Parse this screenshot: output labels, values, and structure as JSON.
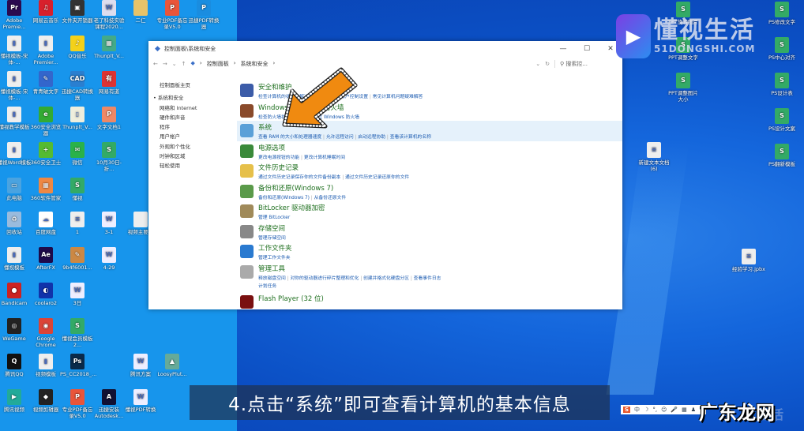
{
  "desktop": {
    "left_icons": [
      {
        "label": "Adobe Premie...",
        "c": "#2a0a4f",
        "g": "Pr"
      },
      {
        "label": "网易云音乐",
        "c": "#d8202c",
        "g": "♫"
      },
      {
        "label": "文件夹开锁器",
        "c": "#333",
        "g": "▣"
      },
      {
        "label": "老了科技实验课程2020...",
        "c": "#dde",
        "g": "W"
      },
      {
        "label": "二仁",
        "c": "#e7c36a",
        "g": ""
      },
      {
        "label": "专业PDF备忘录V5.0",
        "c": "#e9553a",
        "g": "P"
      },
      {
        "label": "迅捷PDF转换器",
        "c": "#1a8de0",
        "g": "P"
      },
      {
        "label": "懂视模板-宋体-...",
        "c": "#eee",
        "g": "▮"
      },
      {
        "label": "Adobe Premier...",
        "c": "#eee",
        "g": "▮"
      },
      {
        "label": "QQ音乐",
        "c": "#f4d11a",
        "g": "♪"
      },
      {
        "label": "Thunplt_V...",
        "c": "#4a8",
        "g": "▦"
      },
      {
        "label": "懂视模板-宋体-...",
        "c": "#eee",
        "g": "▮"
      },
      {
        "label": "青青破文字",
        "c": "#36c",
        "g": "✎"
      },
      {
        "label": "迅捷CAD转换器",
        "c": "#2a7fd0",
        "g": "CAD"
      },
      {
        "label": "网易有道",
        "c": "#d33",
        "g": "有"
      },
      {
        "label": "懂视教学模板",
        "c": "#eee",
        "g": "▮"
      },
      {
        "label": "360安全浏览器",
        "c": "#3a3",
        "g": "e"
      },
      {
        "label": "Thunplt_V...",
        "c": "#eed",
        "g": "▯"
      },
      {
        "label": "文字文档1",
        "c": "#e86",
        "g": "P"
      },
      {
        "label": "懂视Word模板",
        "c": "#eee",
        "g": "▮"
      },
      {
        "label": "360安全卫士",
        "c": "#5b3",
        "g": "+"
      },
      {
        "label": "微信",
        "c": "#2ab24a",
        "g": "✉"
      },
      {
        "label": "10月30日-折...",
        "c": "#3a6",
        "g": "S"
      },
      {
        "label": "此电脑",
        "c": "#4aa3e0",
        "g": "▭"
      },
      {
        "label": "360软件管家",
        "c": "#e84",
        "g": "▦"
      },
      {
        "label": "懂视",
        "c": "#3a6",
        "g": "S"
      },
      {
        "label": "回收站",
        "c": "#9bd",
        "g": "♻"
      },
      {
        "label": "百度网盘",
        "c": "#fff",
        "g": "☁"
      },
      {
        "label": "1",
        "c": "#eee",
        "g": "≡"
      },
      {
        "label": "3-1",
        "c": "#eef",
        "g": "W"
      },
      {
        "label": "视频主要集",
        "c": "#eee",
        "g": ""
      },
      {
        "label": "懂视模板",
        "c": "#eee",
        "g": "▮"
      },
      {
        "label": "AfterFX",
        "c": "#1e0a4a",
        "g": "Ae"
      },
      {
        "label": "9b4f6001...",
        "c": "#c84",
        "g": "✎"
      },
      {
        "label": "4-29",
        "c": "#eef",
        "g": "W"
      },
      {
        "label": "Bandicam",
        "c": "#c22",
        "g": "●"
      },
      {
        "label": "coolaro2",
        "c": "#13a",
        "g": "◐"
      },
      {
        "label": "3日",
        "c": "#eef",
        "g": "W"
      },
      {
        "label": "WeGame",
        "c": "#222",
        "g": "◎"
      },
      {
        "label": "Google Chrome",
        "c": "#db4437",
        "g": "◉"
      },
      {
        "label": "懂视会员模板2...",
        "c": "#3a6",
        "g": "S"
      },
      {
        "label": "腾讯QQ",
        "c": "#111",
        "g": "Q"
      },
      {
        "label": "视频模板",
        "c": "#eee",
        "g": "▮"
      },
      {
        "label": "PS_CC2018_...",
        "c": "#0a2a4a",
        "g": "Ps"
      },
      {
        "label": "腾讯方案",
        "c": "#eef",
        "g": "W"
      },
      {
        "label": "LoosyPlut...",
        "c": "#6a9",
        "g": "▲"
      },
      {
        "label": "腾讯视频",
        "c": "#2a9",
        "g": "▶"
      },
      {
        "label": "视频剪辑器",
        "c": "#222",
        "g": "◆"
      },
      {
        "label": "专业PDF备忘录V5.0",
        "c": "#e9553a",
        "g": "P"
      },
      {
        "label": "迅捷安装Autodesk...",
        "c": "#113",
        "g": "A"
      },
      {
        "label": "懂视PDF转换",
        "c": "#eef",
        "g": "W"
      }
    ],
    "right_icons": [
      {
        "label": "PPT旋转图片",
        "c": "#3a6",
        "g": "S"
      },
      {
        "label": "PPT调整文字",
        "c": "#3a6",
        "g": "S"
      },
      {
        "label": "PPT调整图片大小",
        "c": "#3a6",
        "g": "S"
      },
      {
        "label": "PS修改文字",
        "c": "#3a6",
        "g": "S"
      },
      {
        "label": "PS中心对齐",
        "c": "#3a6",
        "g": "S"
      },
      {
        "label": "PS设计表",
        "c": "#3a6",
        "g": "S"
      },
      {
        "label": "PS设计文案",
        "c": "#3a6",
        "g": "S"
      },
      {
        "label": "PS翻新模板",
        "c": "#3a6",
        "g": "S"
      },
      {
        "label": "新建文本文档 (6)",
        "c": "#eee",
        "g": "≡"
      },
      {
        "label": "经验学习.jpbx",
        "c": "#eee",
        "g": "≡"
      }
    ]
  },
  "window": {
    "title": "控制面板\\系统和安全",
    "breadcrumb": [
      "控制面板",
      "系统和安全"
    ],
    "search_placeholder": "搜索控...",
    "controls": {
      "min": "—",
      "max": "☐",
      "close": "✕"
    },
    "nav": {
      "home": "控制面板主页",
      "items": [
        "系统和安全",
        "网络和 Internet",
        "硬件和声音",
        "程序",
        "用户帐户",
        "外观和个性化",
        "时钟和区域",
        "轻松使用"
      ]
    },
    "items": [
      {
        "title": "安全和维护",
        "links": [
          "检查计算机的状态并解决问题",
          "更改用户帐户控制设置",
          "常见计算机问题疑难解答"
        ],
        "c": "#3c5ca8"
      },
      {
        "title": "Windows Defender 防火墙",
        "links": [
          "检查防火墙状态",
          "允许应用通过 Windows 防火墙"
        ],
        "c": "#8a4a2a"
      },
      {
        "title": "系统",
        "links": [
          "查看 RAM 的大小和处理器速度",
          "允许远程访问",
          "启动远程协助",
          "查看该计算机的名称"
        ],
        "c": "#5aa0d8",
        "hl": true
      },
      {
        "title": "电源选项",
        "links": [
          "更改电源按钮的功能",
          "更改计算机睡眠时间"
        ],
        "c": "#3a8a3a"
      },
      {
        "title": "文件历史记录",
        "links": [
          "通过文件历史记录保存你的文件备份副本",
          "通过文件历史记录还原你的文件"
        ],
        "c": "#e6c04a"
      },
      {
        "title": "备份和还原(Windows 7)",
        "links": [
          "备份和还原(Windows 7)",
          "从备份还原文件"
        ],
        "c": "#5a9a4a"
      },
      {
        "title": "BitLocker 驱动器加密",
        "links": [
          "管理 BitLocker"
        ],
        "c": "#a08a5a"
      },
      {
        "title": "存储空间",
        "links": [
          "管理存储空间"
        ],
        "c": "#888"
      },
      {
        "title": "工作文件夹",
        "links": [
          "管理工作文件夹"
        ],
        "c": "#2a7ad0"
      },
      {
        "title": "管理工具",
        "links": [
          "释放磁盘空间",
          "对你的驱动器进行碎片整理和优化",
          "创建并格式化硬盘分区",
          "查看事件日志"
        ],
        "links2": [
          "计划任务"
        ],
        "c": "#aaa"
      },
      {
        "title": "Flash Player (32 位)",
        "links": [],
        "c": "#7a1010"
      }
    ]
  },
  "subtitle": "4.点击“系统”即可查看计算机的基本信息",
  "watermark": {
    "brand": "懂视生活",
    "url": "51DONGSHI.COM",
    "corner": "广东龙网",
    "ghost": "生活"
  },
  "ime": {
    "logo": "S",
    "mode": "中",
    "icons": [
      "☽",
      "°,",
      "☺",
      "🎤",
      "▦",
      "♟",
      "▚"
    ]
  }
}
